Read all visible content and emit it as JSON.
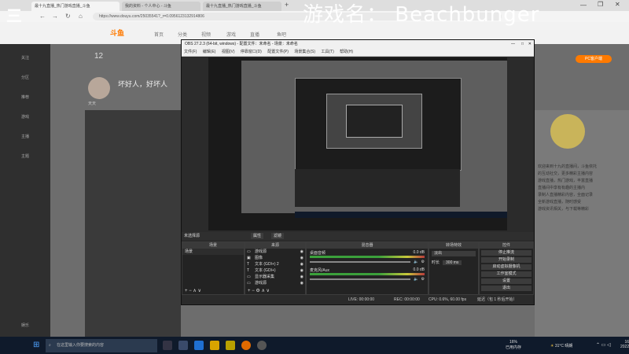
{
  "watermark": {
    "logo": "三",
    "game_name": "游戏名：  Beachbunger"
  },
  "browser": {
    "tabs": [
      {
        "label": "最十九直播_热门游戏直播_斗鱼"
      },
      {
        "label": "我的资料 - 个人中心 - 斗鱼"
      },
      {
        "label": "最十九直播_热门游戏直播_斗鱼"
      }
    ],
    "new_tab": "+",
    "url": "https://www.douyu.com/25035541?_r=0.0956123132914806"
  },
  "douyu": {
    "logo": "斗鱼",
    "nav": [
      "首页",
      "分类",
      "视频",
      "游戏",
      "直播",
      "鱼吧"
    ],
    "follow_count": "12",
    "streamer_name": "坏好人，好坏人",
    "sidebar": [
      "关注",
      "分区",
      "推荐",
      "游戏",
      "主播",
      "主题",
      "娱乐"
    ],
    "pc_badge": "PC客户端",
    "desc_lines": [
      "欢迎来到十九的直播间，斗鱼依托",
      "的互动社交，更多精彩主播内容",
      "游戏直播，热门游戏，丰富直播",
      "直播间中享有有趣的主播内",
      "录制人直播精彩内容，全面记录",
      "全新游戏直播，随时感受",
      "游戏资讯相关，与下载等精彩"
    ],
    "left_caption": "天天"
  },
  "obs": {
    "title": "OBS 27.2.3 (64-bit, windows) - 配置文件：未命名 - 场景：未命名",
    "menu": [
      "文件(F)",
      "编辑(E)",
      "视图(V)",
      "停靠窗口(D)",
      "配置文件(P)",
      "场景集合(S)",
      "工具(T)",
      "帮助(H)"
    ],
    "no_source": "未选择源",
    "props_btn": "属性",
    "filters_btn": "滤镜",
    "docks": {
      "scenes": "场景",
      "sources": "来源",
      "mixer": "混音器",
      "transitions": "转场特效",
      "controls": "控件"
    },
    "scenes": [
      "场景"
    ],
    "sources": [
      {
        "name": "游戏源",
        "icon": "game"
      },
      {
        "name": "图像",
        "icon": "image"
      },
      {
        "name": "文本 (GDI+) 2",
        "icon": "text"
      },
      {
        "name": "文本 (GDI+)",
        "icon": "text"
      },
      {
        "name": "显示器采集",
        "icon": "monitor"
      },
      {
        "name": "游戏源",
        "icon": "game"
      }
    ],
    "mixer": [
      {
        "name": "桌面音频",
        "level": "0.0 dB"
      },
      {
        "name": "麦克风/Aux",
        "level": "0.0 dB"
      }
    ],
    "transition_value": "淡出",
    "duration_label": "时长",
    "duration_value": "300 ms",
    "controls": [
      "停止推流",
      "开始录制",
      "启动虚拟摄像机",
      "工作室模式",
      "设置",
      "退出"
    ],
    "status": {
      "live": "LIVE: 00:00:00",
      "rec": "REC: 00:00:00",
      "cpu": "CPU: 0.6%, 60.00 fps",
      "drop": "延迟（包 1 秒后开始）"
    }
  },
  "taskbar": {
    "search_placeholder": "在这里输入你要搜索的内容",
    "cpu": "16%",
    "cpu_label": "已用内存",
    "weather": "31°C 晴朗",
    "time": "16",
    "date": "2022"
  },
  "colors": {
    "douyu_orange": "#ff7a00",
    "obs_bg": "#2b2b2b",
    "taskbar": "#0f1a2b"
  }
}
